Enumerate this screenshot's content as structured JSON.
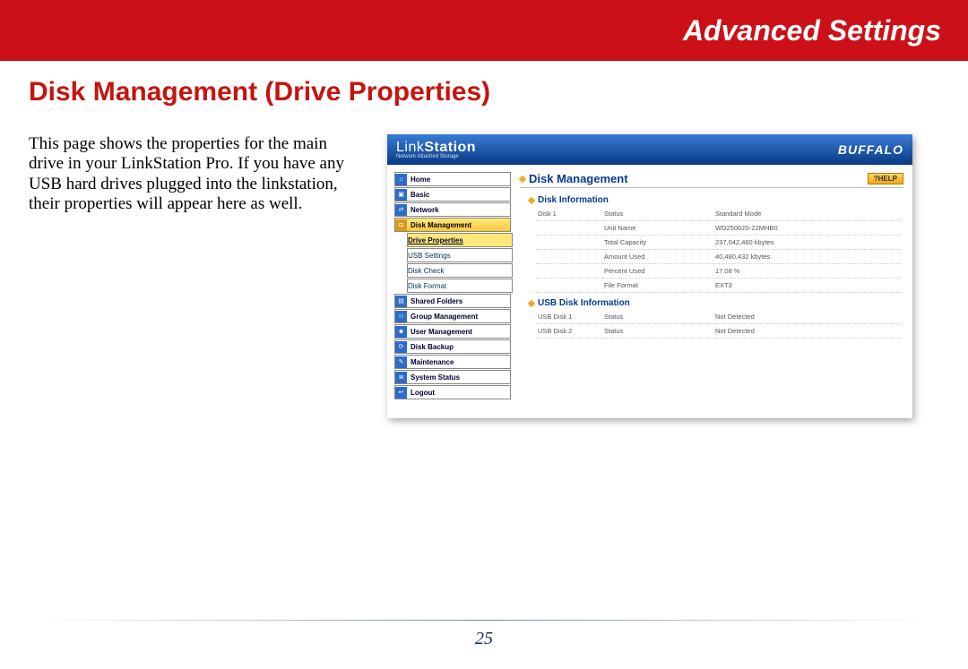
{
  "banner": {
    "title": "Advanced Settings"
  },
  "page_title": "Disk Management (Drive Properties)",
  "body_text": "This page shows the properties for the main drive in your LinkStation Pro.  If you have any USB hard drives plugged into the linkstation, their properties will appear here as well.",
  "page_number": "25",
  "screenshot": {
    "logo_link": "Link",
    "logo_station": "Station",
    "logo_sub": "Network Attached Storage",
    "brand": "BUFFALO",
    "help_label": "?HELP",
    "panel_title": "Disk Management",
    "nav": {
      "home": "Home",
      "basic": "Basic",
      "network": "Network",
      "disk_mgmt": "Disk Management",
      "drive_props": "Drive Properties",
      "usb_settings": "USB Settings",
      "disk_check": "Disk Check",
      "disk_format": "Disk Format",
      "shared_folders": "Shared Folders",
      "group_mgmt": "Group Management",
      "user_mgmt": "User Management",
      "disk_backup": "Disk Backup",
      "maintenance": "Maintenance",
      "system_status": "System Status",
      "logout": "Logout"
    },
    "disk_info": {
      "heading": "Disk Information",
      "rows": [
        {
          "c1": "Disk 1",
          "c2": "Status",
          "c3": "Standard Mode"
        },
        {
          "c1": "",
          "c2": "Unit Name",
          "c3": "WD2500JS-22MHB0"
        },
        {
          "c1": "",
          "c2": "Total Capacity",
          "c3": "237,042,460 kbytes"
        },
        {
          "c1": "",
          "c2": "Amount Used",
          "c3": "40,480,432 kbytes"
        },
        {
          "c1": "",
          "c2": "Percent Used",
          "c3": "17.08 %"
        },
        {
          "c1": "",
          "c2": "File Format",
          "c3": "EXT3"
        }
      ]
    },
    "usb_info": {
      "heading": "USB Disk Information",
      "rows": [
        {
          "c1": "USB Disk 1",
          "c2": "Status",
          "c3": "Not Detected"
        },
        {
          "c1": "USB Disk 2",
          "c2": "Status",
          "c3": "Not Detected"
        }
      ]
    }
  }
}
